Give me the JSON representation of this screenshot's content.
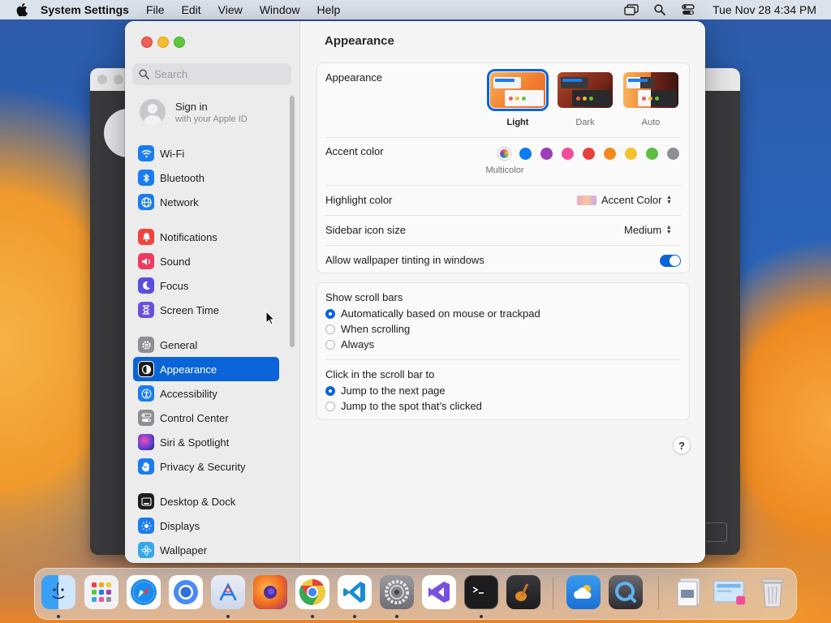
{
  "menubar": {
    "app_name": "System Settings",
    "menus": [
      "File",
      "Edit",
      "View",
      "Window",
      "Help"
    ],
    "icons": [
      "screen-mirroring-icon",
      "spotlight-search-icon",
      "control-center-icon"
    ],
    "clock": "Tue Nov 28  4:34 PM"
  },
  "sidebar": {
    "search_placeholder": "Search",
    "signin": {
      "title": "Sign in",
      "subtitle": "with your Apple ID"
    },
    "groups": [
      [
        {
          "label": "Wi-Fi",
          "icon": "wifi-icon",
          "color": "#1a7cf0"
        },
        {
          "label": "Bluetooth",
          "icon": "bluetooth-icon",
          "color": "#1a7cf0"
        },
        {
          "label": "Network",
          "icon": "network-globe-icon",
          "color": "#1a7cf0"
        }
      ],
      [
        {
          "label": "Notifications",
          "icon": "notifications-bell-icon",
          "color": "#f0443a"
        },
        {
          "label": "Sound",
          "icon": "sound-speaker-icon",
          "color": "#ee3a5e"
        },
        {
          "label": "Focus",
          "icon": "focus-moon-icon",
          "color": "#5b4ee0"
        },
        {
          "label": "Screen Time",
          "icon": "screen-time-hourglass-icon",
          "color": "#6b4fdc"
        }
      ],
      [
        {
          "label": "General",
          "icon": "general-gear-icon",
          "color": "#8e8e93"
        },
        {
          "label": "Appearance",
          "icon": "appearance-icon",
          "color": "#1c1c1e",
          "selected": true
        },
        {
          "label": "Accessibility",
          "icon": "accessibility-icon",
          "color": "#1a7cf0"
        },
        {
          "label": "Control Center",
          "icon": "control-center-icon",
          "color": "#8e8e93"
        },
        {
          "label": "Siri & Spotlight",
          "icon": "siri-icon",
          "color": "#5b3fd6"
        },
        {
          "label": "Privacy & Security",
          "icon": "privacy-hand-icon",
          "color": "#1a7cf0"
        }
      ],
      [
        {
          "label": "Desktop & Dock",
          "icon": "desktop-dock-icon",
          "color": "#1c1c1e"
        },
        {
          "label": "Displays",
          "icon": "displays-sun-icon",
          "color": "#1a7cf0"
        },
        {
          "label": "Wallpaper",
          "icon": "wallpaper-flower-icon",
          "color": "#35a9e8"
        }
      ]
    ]
  },
  "main": {
    "title": "Appearance",
    "appearance": {
      "label": "Appearance",
      "options": [
        {
          "label": "Light",
          "selected": true
        },
        {
          "label": "Dark",
          "selected": false
        },
        {
          "label": "Auto",
          "selected": false
        }
      ]
    },
    "accent": {
      "label": "Accent color",
      "caption": "Multicolor",
      "colors": [
        "multicolor",
        "#0a7bf5",
        "#9a3fb8",
        "#f0509b",
        "#e8403c",
        "#f28a1e",
        "#f6c12e",
        "#5fbd44",
        "#8e8e93"
      ]
    },
    "highlight": {
      "label": "Highlight color",
      "value": "Accent Color"
    },
    "sidebar_icon_size": {
      "label": "Sidebar icon size",
      "value": "Medium"
    },
    "wallpaper_tinting": {
      "label": "Allow wallpaper tinting in windows",
      "enabled": true
    },
    "scroll_bars": {
      "label": "Show scroll bars",
      "options": [
        {
          "label": "Automatically based on mouse or trackpad",
          "selected": true
        },
        {
          "label": "When scrolling",
          "selected": false
        },
        {
          "label": "Always",
          "selected": false
        }
      ]
    },
    "click_scroll": {
      "label": "Click in the scroll bar to",
      "options": [
        {
          "label": "Jump to the next page",
          "selected": true
        },
        {
          "label": "Jump to the spot that’s clicked",
          "selected": false
        }
      ]
    },
    "help": "?"
  },
  "dock": {
    "apps": [
      {
        "name": "finder-icon",
        "running": true
      },
      {
        "name": "launchpad-icon",
        "running": false
      },
      {
        "name": "safari-icon",
        "running": false
      },
      {
        "name": "chromium-icon",
        "running": false
      },
      {
        "name": "app-store-icon",
        "running": true
      },
      {
        "name": "firefox-icon",
        "running": false
      },
      {
        "name": "chrome-icon",
        "running": true
      },
      {
        "name": "vscode-icon",
        "running": true
      },
      {
        "name": "system-settings-icon",
        "running": true
      },
      {
        "name": "visual-studio-icon",
        "running": false
      },
      {
        "name": "terminal-icon",
        "running": true
      },
      {
        "name": "garageband-icon",
        "running": false
      },
      {
        "name": "icloud-weather-icon",
        "running": false
      },
      {
        "name": "quicktime-icon",
        "running": false
      },
      {
        "name": "file-stack-icon",
        "running": false
      },
      {
        "name": "preview-document-icon",
        "running": false
      },
      {
        "name": "trash-icon",
        "running": false
      }
    ]
  }
}
